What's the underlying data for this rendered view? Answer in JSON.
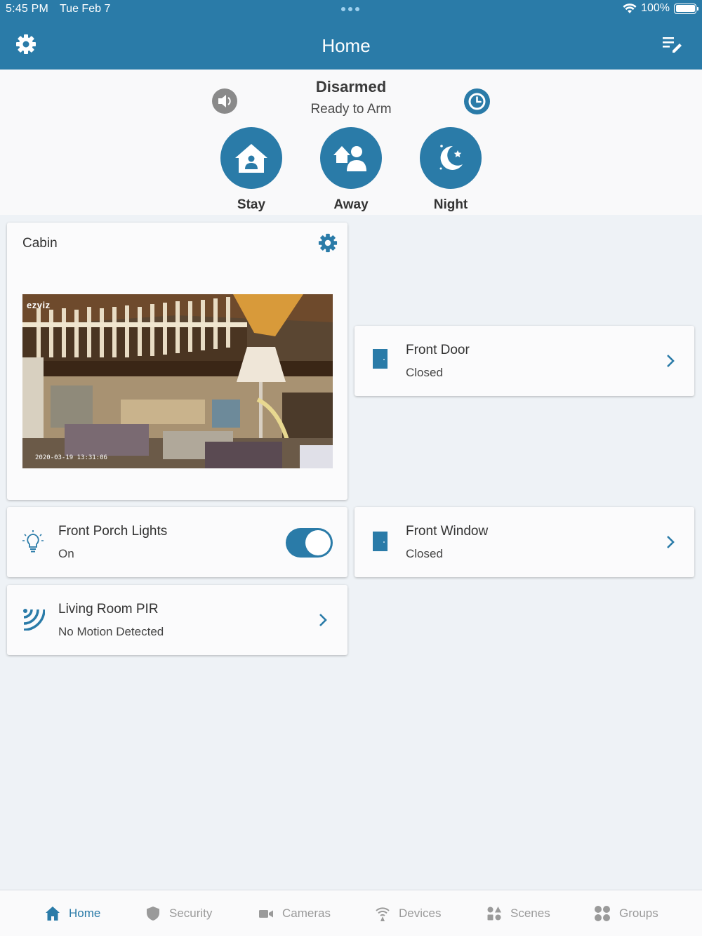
{
  "status_bar": {
    "time": "5:45 PM",
    "date": "Tue Feb 7",
    "battery": "100%"
  },
  "header": {
    "title": "Home"
  },
  "arm": {
    "status": "Disarmed",
    "subtitle": "Ready to Arm",
    "modes": [
      {
        "label": "Stay"
      },
      {
        "label": "Away"
      },
      {
        "label": "Night"
      }
    ]
  },
  "camera_card": {
    "name": "Cabin",
    "brand": "ezviz",
    "timestamp": "2020-03-19 13:31:06"
  },
  "devices": {
    "front_door": {
      "name": "Front Door",
      "state": "Closed"
    },
    "front_porch_lights": {
      "name": "Front Porch Lights",
      "state": "On",
      "toggle_on": true
    },
    "front_window": {
      "name": "Front Window",
      "state": "Closed"
    },
    "living_room_pir": {
      "name": "Living Room PIR",
      "state": "No Motion Detected"
    }
  },
  "tabs": [
    {
      "label": "Home",
      "icon": "home-icon",
      "active": true
    },
    {
      "label": "Security",
      "icon": "shield-icon",
      "active": false
    },
    {
      "label": "Cameras",
      "icon": "camera-icon",
      "active": false
    },
    {
      "label": "Devices",
      "icon": "wifi-icon",
      "active": false
    },
    {
      "label": "Scenes",
      "icon": "scenes-icon",
      "active": false
    },
    {
      "label": "Groups",
      "icon": "groups-icon",
      "active": false
    }
  ],
  "colors": {
    "primary": "#2a7ba8",
    "inactive": "#9a9a9a",
    "background": "#eef2f6"
  }
}
